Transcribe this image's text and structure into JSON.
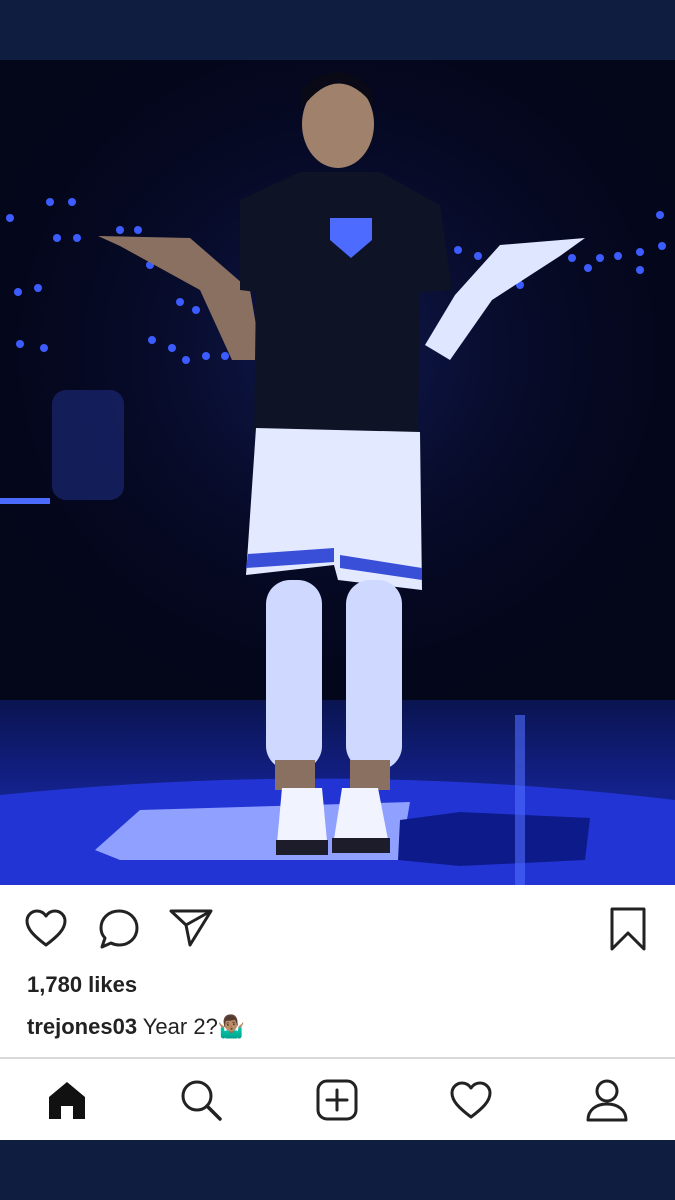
{
  "post": {
    "photo_alt": "",
    "likes_text": "1,780 likes",
    "username": "trejones03",
    "caption_text": " Year 2?🤷🏽‍♂️"
  },
  "actions": {
    "like_icon": "heart-outline-icon",
    "comment_icon": "speech-bubble-icon",
    "share_icon": "paper-plane-icon",
    "save_icon": "bookmark-icon"
  },
  "tabbar": {
    "tabs": [
      {
        "icon": "home-icon",
        "active": true
      },
      {
        "icon": "search-icon",
        "active": false
      },
      {
        "icon": "add-post-icon",
        "active": false
      },
      {
        "icon": "activity-heart-icon",
        "active": false
      },
      {
        "icon": "profile-icon",
        "active": false
      }
    ]
  },
  "colors": {
    "frame": "#0f1d40",
    "stage_blue": "#2a3fd8",
    "text": "#222222"
  }
}
